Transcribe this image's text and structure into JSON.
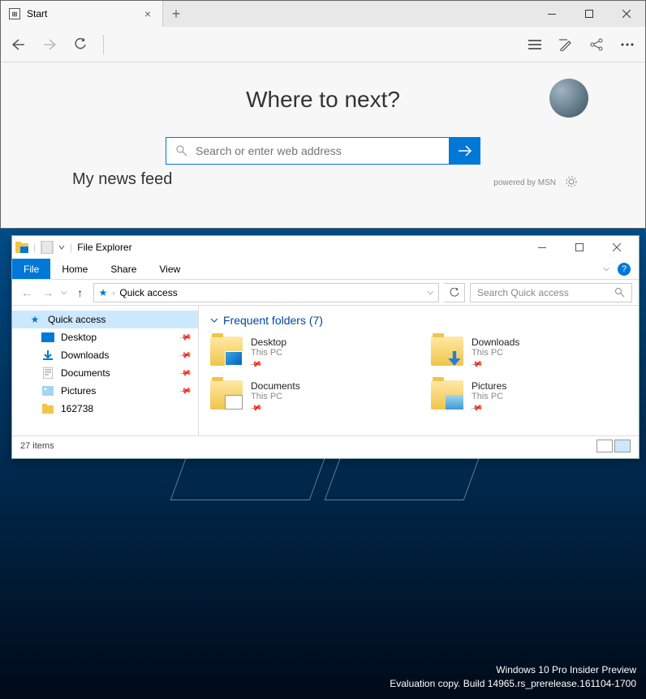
{
  "edge": {
    "tab": {
      "label": "Start"
    },
    "heading": "Where to next?",
    "search_placeholder": "Search or enter web address",
    "news_feed_label": "My news feed",
    "powered_label": "powered by MSN"
  },
  "explorer": {
    "title": "File Explorer",
    "ribbon": {
      "file": "File",
      "home": "Home",
      "share": "Share",
      "view": "View"
    },
    "breadcrumb": "Quick access",
    "search_placeholder": "Search Quick access",
    "sidebar": {
      "quick_access": "Quick access",
      "items": [
        {
          "name": "Desktop"
        },
        {
          "name": "Downloads"
        },
        {
          "name": "Documents"
        },
        {
          "name": "Pictures"
        },
        {
          "name": "162738"
        }
      ]
    },
    "section": {
      "label": "Frequent folders (7)"
    },
    "folders": [
      {
        "name": "Desktop",
        "location": "This PC",
        "overlay": "fi-desktop"
      },
      {
        "name": "Downloads",
        "location": "This PC",
        "overlay": "fi-download"
      },
      {
        "name": "Documents",
        "location": "This PC",
        "overlay": "fi-doc"
      },
      {
        "name": "Pictures",
        "location": "This PC",
        "overlay": "fi-pic"
      }
    ],
    "status": "27 items"
  },
  "watermark": {
    "line1": "Windows 10 Pro Insider Preview",
    "line2": "Evaluation copy. Build 14965.rs_prerelease.161104-1700"
  }
}
